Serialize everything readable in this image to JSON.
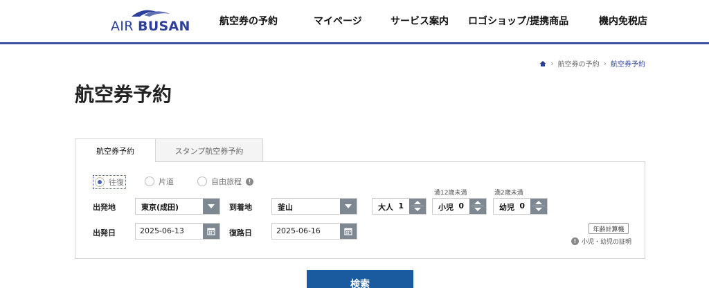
{
  "brand": {
    "logo_air": "AIR",
    "logo_busan": "BUSAN",
    "color": "#2c3f9a"
  },
  "nav": {
    "items": [
      {
        "label": "航空券の予約"
      },
      {
        "label": "マイページ"
      },
      {
        "label": "サービス案内"
      },
      {
        "label": "ロゴショップ/提携商品"
      },
      {
        "label": "機内免税店"
      }
    ]
  },
  "breadcrumb": {
    "home_icon": "home-icon",
    "items": [
      {
        "label": "航空券の予約"
      },
      {
        "label": "航空券予約"
      }
    ]
  },
  "page": {
    "title": "航空券予約"
  },
  "tabs": [
    {
      "label": "航空券予約",
      "active": true
    },
    {
      "label": "スタンプ航空券予約",
      "active": false
    }
  ],
  "trip_type": {
    "options": [
      {
        "label": "往復",
        "selected": true
      },
      {
        "label": "片道",
        "selected": false
      },
      {
        "label": "自由旅程",
        "selected": false
      }
    ]
  },
  "form": {
    "origin": {
      "label": "出発地",
      "value": "東京(成田)"
    },
    "destination": {
      "label": "到着地",
      "value": "釜山"
    },
    "passengers": {
      "adult": {
        "label": "大人",
        "count": "1"
      },
      "child": {
        "label": "小児",
        "count": "0",
        "note": "満12歳未満"
      },
      "infant": {
        "label": "幼児",
        "count": "0",
        "note": "満2歳未満"
      }
    },
    "departure_date": {
      "label": "出発日",
      "value": "2025-06-13"
    },
    "return_date": {
      "label": "復路日",
      "value": "2025-06-16"
    },
    "age_calc_label": "年齢計算機",
    "proof_note": "小児・幼児の証明"
  },
  "search": {
    "label": "検索",
    "color": "#1a5a9e"
  }
}
